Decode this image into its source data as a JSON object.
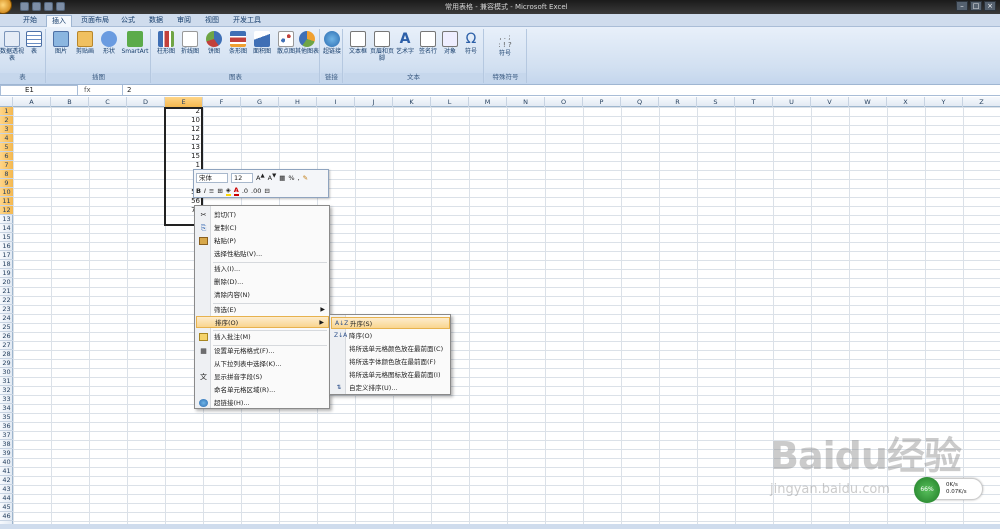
{
  "window": {
    "title": "常用表格 - 兼容模式 - Microsoft Excel",
    "controls": [
      "–",
      "□",
      "×"
    ]
  },
  "tabs": [
    "开始",
    "插入",
    "页面布局",
    "公式",
    "数据",
    "审阅",
    "视图",
    "开发工具"
  ],
  "active_tab": "插入",
  "ribbon": {
    "groups": [
      {
        "label": "表",
        "buttons": [
          "数据透视表",
          "表"
        ]
      },
      {
        "label": "插图",
        "buttons": [
          "图片",
          "剪贴画",
          "形状",
          "SmartArt"
        ]
      },
      {
        "label": "图表",
        "buttons": [
          "柱形图",
          "折线图",
          "饼图",
          "条形图",
          "面积图",
          "散点图",
          "其他图表"
        ]
      },
      {
        "label": "链接",
        "buttons": [
          "超链接"
        ]
      },
      {
        "label": "文本",
        "buttons": [
          "文本框",
          "页眉和页脚",
          "艺术字",
          "签名行",
          "对象",
          "符号"
        ]
      },
      {
        "label": "特殊符号",
        "buttons": [
          "符号"
        ]
      }
    ]
  },
  "formula_bar": {
    "name_box": "E1",
    "fx": "fx",
    "value": "2"
  },
  "columns": [
    "A",
    "B",
    "C",
    "D",
    "E",
    "F",
    "G",
    "H",
    "I",
    "J",
    "K",
    "L",
    "M",
    "N",
    "O",
    "P",
    "Q",
    "R",
    "S",
    "T",
    "U",
    "V",
    "W",
    "X",
    "Y",
    "Z"
  ],
  "rows": [
    "1",
    "2",
    "3",
    "4",
    "5",
    "6",
    "7",
    "8",
    "9",
    "10",
    "11",
    "12",
    "13",
    "14",
    "15",
    "16",
    "17",
    "18",
    "19",
    "20",
    "21",
    "22",
    "23",
    "24",
    "25",
    "26",
    "27",
    "28",
    "29",
    "30",
    "31",
    "32",
    "33",
    "34",
    "35",
    "36",
    "37",
    "38",
    "39",
    "40",
    "41",
    "42",
    "43",
    "44",
    "45",
    "46"
  ],
  "cells_E": [
    "2",
    "10",
    "12",
    "12",
    "13",
    "15",
    "1",
    "3",
    "3",
    "56",
    "56",
    "78"
  ],
  "mini_toolbar": {
    "font": "宋体",
    "size": "12",
    "percent": "%",
    "comma": ",",
    "bold": "B",
    "italic": "I"
  },
  "context_menu": [
    {
      "label": "剪切(T)",
      "icon": "✂"
    },
    {
      "label": "复制(C)",
      "icon": "⎘"
    },
    {
      "label": "粘贴(P)",
      "icon": "📋"
    },
    {
      "label": "选择性粘贴(V)...",
      "icon": ""
    },
    {
      "label": "插入(I)...",
      "icon": ""
    },
    {
      "label": "删除(D)...",
      "icon": ""
    },
    {
      "label": "清除内容(N)",
      "icon": ""
    },
    {
      "label": "筛选(E)",
      "icon": ""
    },
    {
      "label": "排序(O)",
      "icon": ""
    },
    {
      "label": "插入批注(M)",
      "icon": "▭"
    },
    {
      "label": "设置单元格格式(F)...",
      "icon": "▦"
    },
    {
      "label": "从下拉列表中选择(K)...",
      "icon": ""
    },
    {
      "label": "显示拼音字段(S)",
      "icon": "文"
    },
    {
      "label": "命名单元格区域(R)...",
      "icon": ""
    },
    {
      "label": "超链接(H)...",
      "icon": "🌐"
    }
  ],
  "sort_submenu": [
    {
      "label": "升序(S)",
      "icon": "A↓Z"
    },
    {
      "label": "降序(O)",
      "icon": "Z↓A"
    },
    {
      "label": "将所选单元格颜色放在最前面(C)",
      "icon": ""
    },
    {
      "label": "将所选字体颜色放在最前面(F)",
      "icon": ""
    },
    {
      "label": "将所选单元格图标放在最前面(I)",
      "icon": ""
    },
    {
      "label": "自定义排序(U)...",
      "icon": "⇅"
    }
  ],
  "watermark": {
    "brand": "Baidu经验",
    "url": "jingyan.baidu.com"
  },
  "net_widget": {
    "value": "0K/s",
    "percent": "0.07K/s",
    "ball": "66%"
  }
}
